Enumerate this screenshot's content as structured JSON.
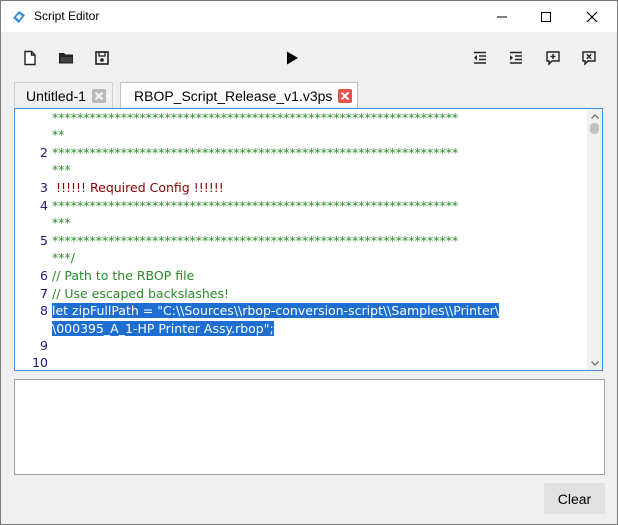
{
  "window": {
    "title": "Script Editor",
    "icons": {
      "app": "script-editor-app-icon",
      "minimize": "minimize-icon",
      "maximize": "maximize-icon",
      "close": "close-icon"
    }
  },
  "toolbar": {
    "left": [
      "new-file-icon",
      "open-folder-icon",
      "save-icon"
    ],
    "center": "run-icon",
    "right": [
      "decrease-indent-icon",
      "increase-indent-icon",
      "add-comment-icon",
      "remove-comment-icon"
    ]
  },
  "tabs": [
    {
      "label": "Untitled-1",
      "active": false
    },
    {
      "label": "RBOP_Script_Release_v1.v3ps",
      "active": true
    }
  ],
  "editor": {
    "line_numbers": [
      "2",
      "3",
      "4",
      "5",
      "6",
      "7",
      "8",
      "9",
      "10"
    ],
    "lines": [
      "**",
      "*****************************************************************",
      "***",
      " !!!!!! Required Config !!!!!!",
      "*****************************************************************",
      "***",
      "*****************************************************************",
      "***/",
      "// Path to the RBOP file",
      "// Use escaped backslashes!",
      "let zipFullPath = \"C:\\\\Sources\\\\rbop-conversion-script\\\\Samples\\\\Printer\\",
      "\\000395_A_1-HP Printer Assy.rbop\";"
    ],
    "first_line": "*****************************************************************"
  },
  "output": {
    "text": ""
  },
  "buttons": {
    "clear": "Clear"
  },
  "colors": {
    "comment": "#2a8a2a",
    "selection": "#1c6fd1",
    "line_number": "#1a1a7a",
    "editor_border": "#4a90d9"
  }
}
